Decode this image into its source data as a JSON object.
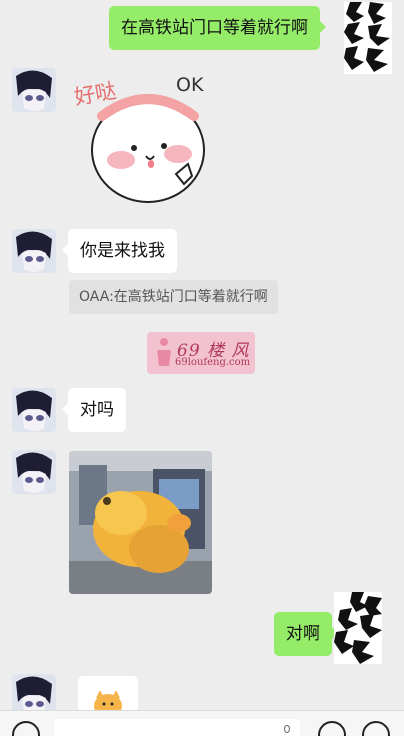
{
  "messages": [
    {
      "side": "right",
      "text": "在高铁站门口等着就行啊"
    },
    {
      "side": "left",
      "type": "sticker",
      "sticker_text_1": "好哒",
      "sticker_text_2": "OK"
    },
    {
      "side": "left",
      "text": "你是来找我"
    },
    {
      "quote_text": "OAA:在高铁站门口等着就行啊"
    },
    {
      "side": "left",
      "text": "对吗"
    },
    {
      "side": "left",
      "type": "image"
    },
    {
      "side": "right",
      "text": "对啊"
    },
    {
      "side": "left",
      "type": "sticker-partial"
    }
  ],
  "watermark": {
    "main": "69 楼 风",
    "sub": "69loufeng.com"
  },
  "colors": {
    "background": "#ededed",
    "bubble_right": "#95ec69",
    "bubble_left": "#ffffff",
    "quote_bg": "#e1e1e1"
  },
  "icons": {
    "input_left": "voice-icon",
    "input_right_1": "emoji-icon",
    "input_right_2": "plus-icon"
  }
}
